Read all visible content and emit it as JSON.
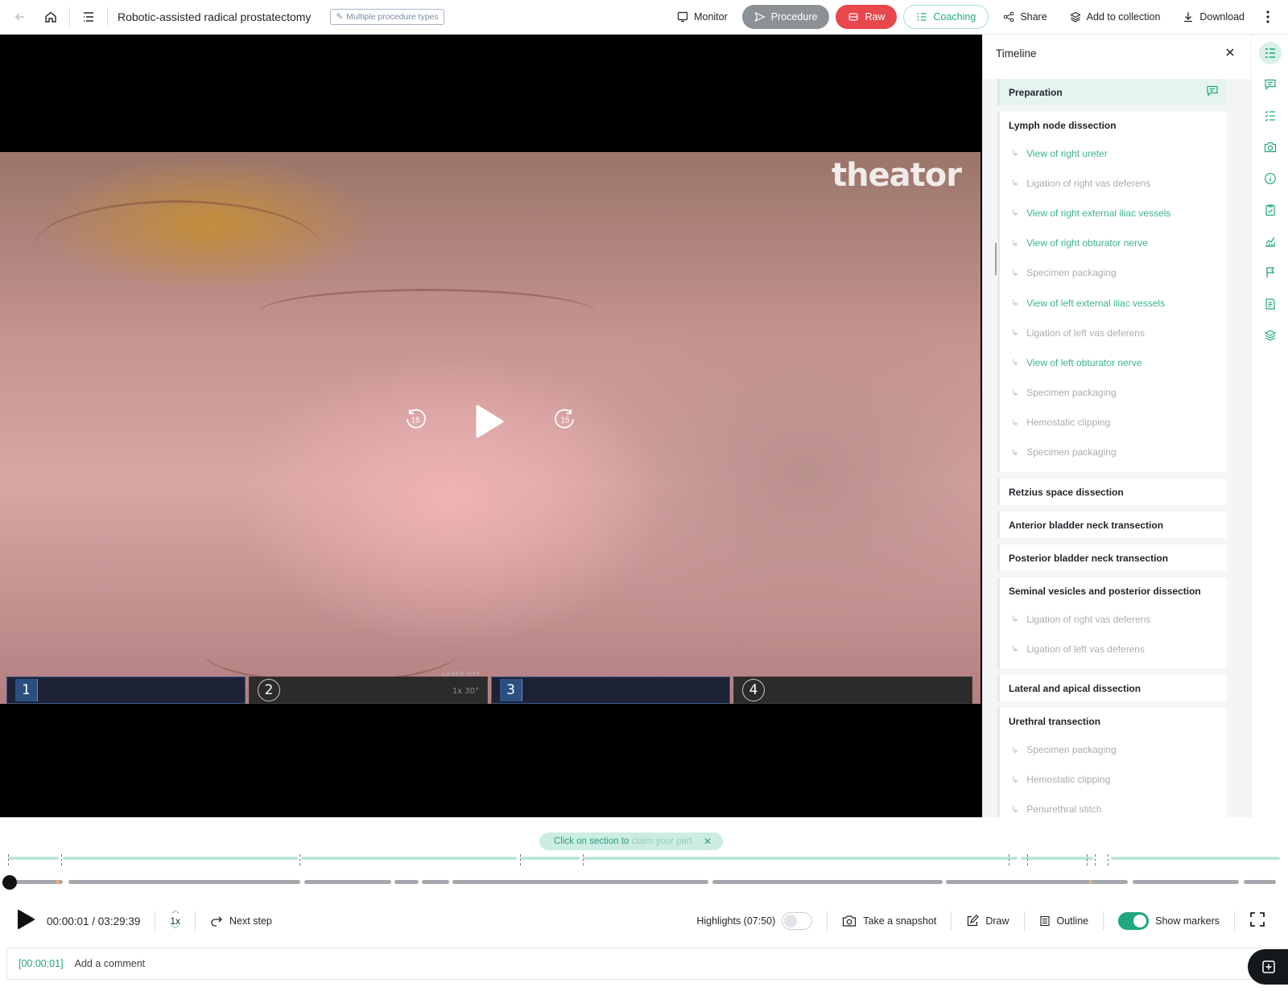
{
  "header": {
    "title": "Robotic-assisted radical prostatectomy",
    "tag": "Multiple procedure types",
    "monitor": "Monitor",
    "procedure": "Procedure",
    "raw": "Raw",
    "coaching": "Coaching",
    "share": "Share",
    "add_to_collection": "Add to collection",
    "download": "Download"
  },
  "video": {
    "watermark": "theator",
    "rewind_label": "15",
    "forward_label": "15",
    "hud": [
      "1",
      "2",
      "3",
      "4"
    ],
    "hud_text": "LASER OFF",
    "hud_zoom": "1x 30°"
  },
  "timeline": {
    "title": "Timeline",
    "sections": [
      {
        "name": "Preparation",
        "active": true,
        "comment_icon": true,
        "steps": []
      },
      {
        "name": "Lymph node dissection",
        "steps": [
          {
            "label": "View of right ureter",
            "color": "green"
          },
          {
            "label": "Ligation of right vas deferens",
            "color": "grey"
          },
          {
            "label": "View of right external iliac vessels",
            "color": "green"
          },
          {
            "label": "View of right obturator nerve",
            "color": "green"
          },
          {
            "label": "Specimen packaging",
            "color": "grey"
          },
          {
            "label": "View of left external iliac vessels",
            "color": "green"
          },
          {
            "label": "Ligation of left vas deferens",
            "color": "grey"
          },
          {
            "label": "View of left obturator nerve",
            "color": "green"
          },
          {
            "label": "Specimen packaging",
            "color": "grey"
          },
          {
            "label": "Hemostatic clipping",
            "color": "grey"
          },
          {
            "label": "Specimen packaging",
            "color": "grey"
          }
        ]
      },
      {
        "name": "Retzius space dissection",
        "steps": []
      },
      {
        "name": "Anterior bladder neck transection",
        "steps": []
      },
      {
        "name": "Posterior bladder neck transection",
        "steps": []
      },
      {
        "name": "Seminal vesicles and posterior dissection",
        "steps": [
          {
            "label": "Ligation of right vas deferens",
            "color": "grey"
          },
          {
            "label": "Ligation of left vas deferens",
            "color": "grey"
          }
        ]
      },
      {
        "name": "Lateral and apical dissection",
        "steps": []
      },
      {
        "name": "Urethral transection",
        "steps": [
          {
            "label": "Specimen packaging",
            "color": "grey"
          },
          {
            "label": "Hemostatic clipping",
            "color": "grey"
          },
          {
            "label": "Periurethral stitch",
            "color": "grey"
          }
        ]
      }
    ]
  },
  "rail_icons": [
    "steps-icon",
    "comment-icon",
    "checklist-icon",
    "camera-icon",
    "info-icon",
    "clipboard-icon",
    "analytics-icon",
    "flag-icon",
    "notes-icon",
    "layers-icon"
  ],
  "hint": {
    "text": "Click on section to",
    "fade": "claim your part"
  },
  "playback": {
    "progress": 0.0001,
    "current_time": "00:00:01",
    "total_time": "03:29:39",
    "time_display": "00:00:01 / 03:29:39",
    "speed": "1x",
    "next_step": "Next step",
    "highlights": "Highlights (07:50)",
    "highlights_on": false,
    "snapshot": "Take a snapshot",
    "draw": "Draw",
    "outline": "Outline",
    "show_markers": "Show markers",
    "show_markers_on": true
  },
  "comment": {
    "timestamp": "[00:00:01]",
    "placeholder": "Add a comment"
  },
  "colors": {
    "accent": "#20a77f",
    "raw": "#e8474b",
    "procedure": "#8c9195"
  }
}
